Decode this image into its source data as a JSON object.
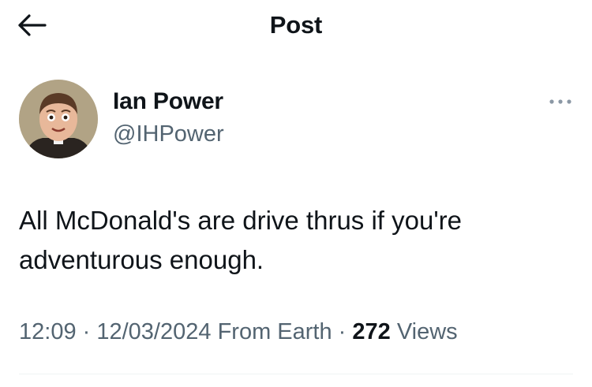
{
  "header": {
    "title": "Post",
    "back_icon": "arrow-left-icon"
  },
  "author": {
    "display_name": "Ian Power",
    "handle": "@IHPower",
    "avatar_icon": "avatar-image"
  },
  "more_icon": "more-horizontal-icon",
  "tweet": {
    "text": "All McDonald's are drive thrus if you're adventurous enough."
  },
  "meta": {
    "time": "12:09",
    "sep1": " · ",
    "date": "12/03/2024",
    "source": " From Earth",
    "sep2": " · ",
    "views_count": "272",
    "views_label": " Views"
  },
  "colors": {
    "text": "#0f1419",
    "secondary": "#536471",
    "divider": "#eff3f4"
  }
}
